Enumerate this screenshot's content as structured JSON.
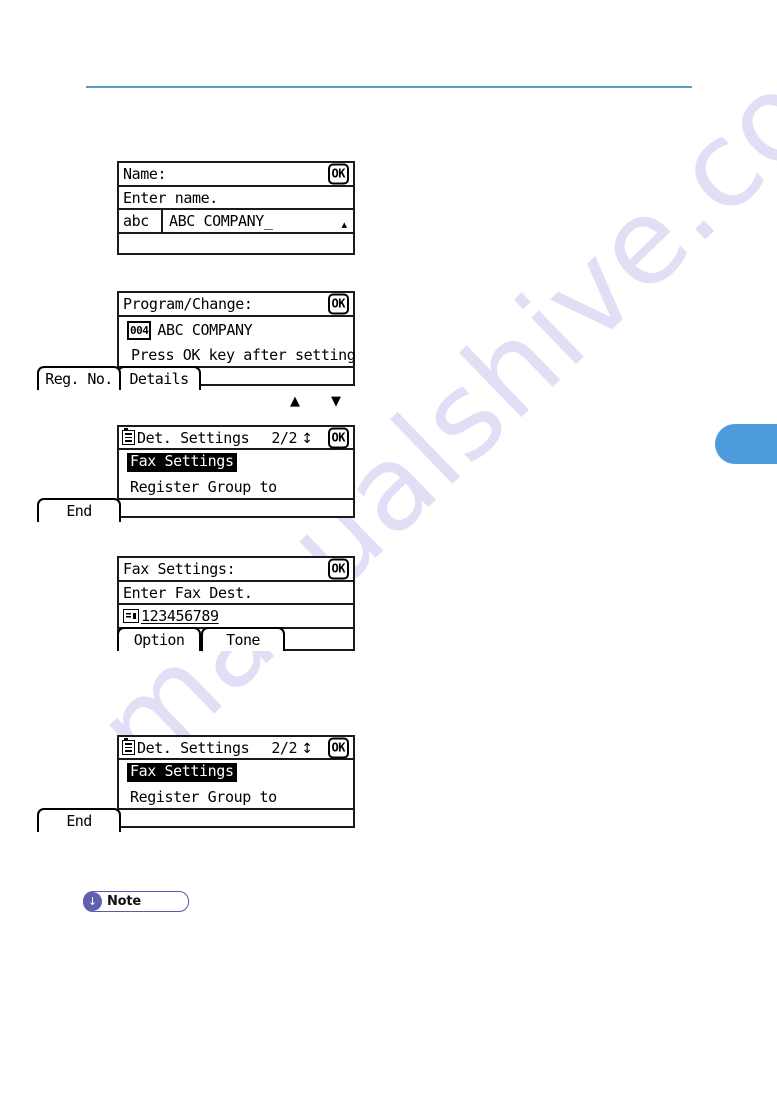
{
  "page": {
    "watermark_text": "manualshive.com",
    "rule_color": "#5b9bc4",
    "side_tab_color": "#4e9bdb",
    "note_accent_color": "#5f5fae"
  },
  "flow_arrows": {
    "up": "▲",
    "down": "▼"
  },
  "note": {
    "icon": "down-arrow-circle-icon",
    "arrow_glyph": "↓",
    "label": "Note"
  },
  "panels": [
    {
      "id": "name-entry",
      "title": "Name:",
      "ok_label": "OK",
      "prompt": "Enter name.",
      "mode_label": "abc",
      "value": "ABC COMPANY_",
      "scroll_glyph": "▴"
    },
    {
      "id": "program-change",
      "title": "Program/Change:",
      "ok_label": "OK",
      "reg_badge": "004",
      "entry_name": "ABC COMPANY",
      "instruction": "Press OK key after setting",
      "softkeys": [
        {
          "label": "Details"
        },
        {
          "label": "Reg. No."
        }
      ]
    },
    {
      "id": "det-settings-1",
      "title": "Det. Settings",
      "page_indicator": "2/2",
      "updown_glyph": "↕",
      "ok_label": "OK",
      "items": [
        {
          "label": "Fax Settings",
          "selected": true
        },
        {
          "label": "Register Group to",
          "selected": false
        }
      ],
      "softkeys": [
        {
          "label": "End"
        }
      ]
    },
    {
      "id": "fax-settings",
      "title": "Fax Settings:",
      "ok_label": "OK",
      "prompt": "Enter Fax Dest.",
      "fax_number": "123456789",
      "softkeys": [
        {
          "label": "Option"
        },
        {
          "label": "Tone"
        }
      ]
    },
    {
      "id": "det-settings-2",
      "title": "Det. Settings",
      "page_indicator": "2/2",
      "updown_glyph": "↕",
      "ok_label": "OK",
      "items": [
        {
          "label": "Fax Settings",
          "selected": true
        },
        {
          "label": "Register Group to",
          "selected": false
        }
      ],
      "softkeys": [
        {
          "label": "End"
        }
      ]
    }
  ]
}
